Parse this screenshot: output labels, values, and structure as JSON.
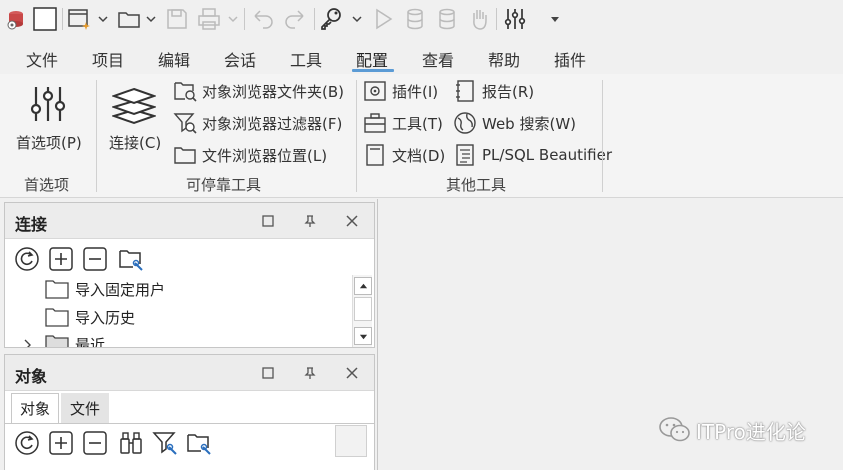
{
  "menu": {
    "tabs": [
      "文件",
      "项目",
      "编辑",
      "会话",
      "工具",
      "配置",
      "查看",
      "帮助",
      "插件"
    ],
    "active_tab": "配置"
  },
  "ribbon": {
    "preferences": {
      "label": "首选项(P)",
      "group": "首选项"
    },
    "dockable": {
      "connection": "连接(C)",
      "items": [
        "对象浏览器文件夹(B)",
        "对象浏览器过滤器(F)",
        "文件浏览器位置(L)"
      ],
      "group": "可停靠工具"
    },
    "other": {
      "col1": [
        "插件(I)",
        "工具(T)",
        "文档(D)"
      ],
      "col2": [
        "报告(R)",
        "Web 搜索(W)",
        "PL/SQL Beautifier"
      ],
      "group": "其他工具"
    }
  },
  "connection_panel": {
    "title": "连接",
    "tree": [
      "导入固定用户",
      "导入历史",
      "最近"
    ]
  },
  "object_panel": {
    "title": "对象",
    "tabs": [
      "对象",
      "文件"
    ]
  },
  "watermark": "ITPro进化论",
  "colors": {
    "accent": "#5b9bd5",
    "ribbon_bg": "#f4f4f4",
    "panel_header": "#ececec"
  }
}
